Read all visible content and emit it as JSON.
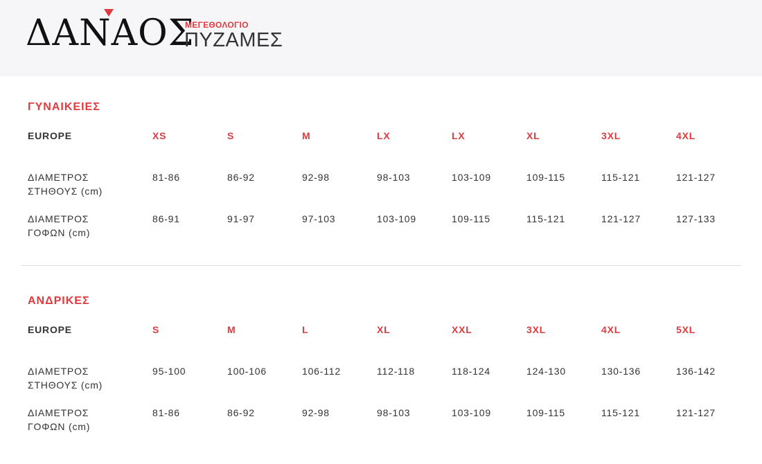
{
  "brand": {
    "logo_text": "ΔΑΝΑΟΣ"
  },
  "header": {
    "subtitle": "ΜΕΓΕΘΟΛΟΓΙΟ",
    "title": "ΠΥΖΑΜΕΣ"
  },
  "colors": {
    "accent": "#e03a3e",
    "text": "#333333",
    "header_bg": "#f6f6f8",
    "divider": "#dddddd"
  },
  "sections": [
    {
      "title": "ΓΥΝΑΙΚΕΙΕΣ",
      "header_label": "EUROPE",
      "sizes": [
        "XS",
        "S",
        "M",
        "LX",
        "LX",
        "XL",
        "3XL",
        "4XL"
      ],
      "rows": [
        {
          "label": [
            "ΔΙΑΜΕΤΡΟΣ",
            "ΣΤΗΘΟΥΣ (cm)"
          ],
          "values": [
            "81-86",
            "86-92",
            "92-98",
            "98-103",
            "103-109",
            "109-115",
            "115-121",
            "121-127"
          ]
        },
        {
          "label": [
            "ΔΙΑΜΕΤΡΟΣ",
            "ΓΟΦΩΝ (cm)"
          ],
          "values": [
            "86-91",
            "91-97",
            "97-103",
            "103-109",
            "109-115",
            "115-121",
            "121-127",
            "127-133"
          ]
        }
      ]
    },
    {
      "title": "ΑΝΔΡΙΚΕΣ",
      "header_label": "EUROPE",
      "sizes": [
        "S",
        "M",
        "L",
        "XL",
        "XXL",
        "3XL",
        "4XL",
        "5XL"
      ],
      "rows": [
        {
          "label": [
            "ΔΙΑΜΕΤΡΟΣ",
            "ΣΤΗΘΟΥΣ (cm)"
          ],
          "values": [
            "95-100",
            "100-106",
            "106-112",
            "112-118",
            "118-124",
            "124-130",
            "130-136",
            "136-142"
          ]
        },
        {
          "label": [
            "ΔΙΑΜΕΤΡΟΣ",
            "ΓΟΦΩΝ (cm)"
          ],
          "values": [
            "81-86",
            "86-92",
            "92-98",
            "98-103",
            "103-109",
            "109-115",
            "115-121",
            "121-127"
          ]
        }
      ]
    }
  ]
}
